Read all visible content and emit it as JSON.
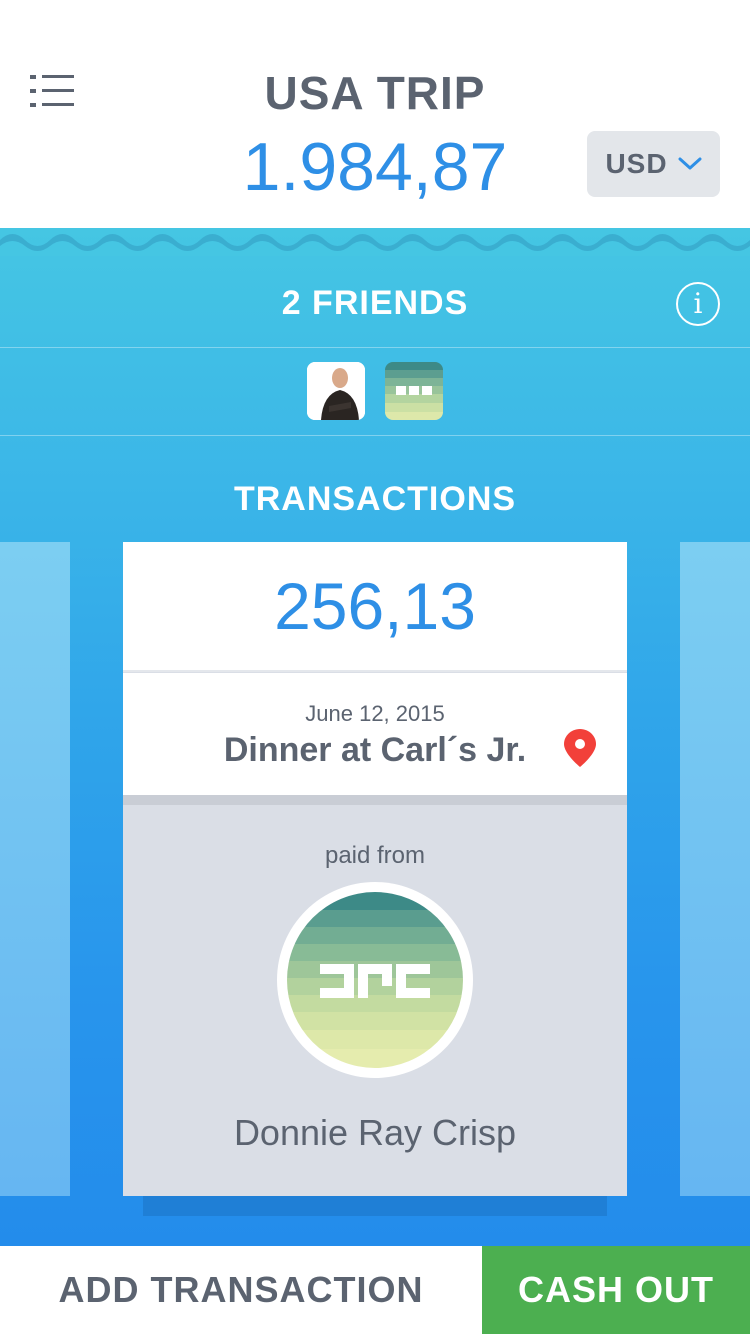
{
  "header": {
    "title": "USA TRIP",
    "total": "1.984,87",
    "currency": "USD",
    "menu_icon": "list-menu-icon",
    "currency_icon": "chevron-down-icon"
  },
  "friends": {
    "title": "2 FRIENDS",
    "info_icon": "info-icon",
    "avatars": [
      "man-photo-avatar",
      "striped-logo-avatar"
    ]
  },
  "transactions": {
    "title": "TRANSACTIONS",
    "card": {
      "amount": "256,13",
      "date": "June 12, 2015",
      "description": "Dinner at Carl´s Jr.",
      "location_icon": "map-pin-icon",
      "paid_from_label": "paid from",
      "payer_name": "Donnie Ray Crisp"
    }
  },
  "bottom": {
    "add_label": "ADD TRANSACTION",
    "cash_out_label": "CASH OUT"
  },
  "colors": {
    "accent_blue": "#2e8fe6",
    "text_gray": "#5b6370",
    "cash_out_green": "#4caf50",
    "wave_cyan": "#45c6e3"
  }
}
